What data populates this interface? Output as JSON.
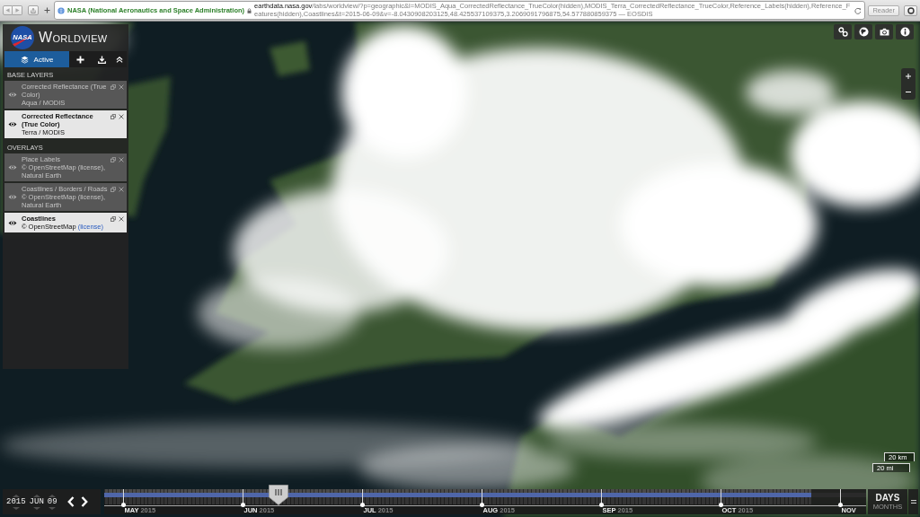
{
  "browser": {
    "identity": "NASA (National Aeronautics and Space Administration)",
    "url_host": "earthdata.nasa.gov",
    "url_path": "/labs/worldview/?p=geographic&l=MODIS_Aqua_CorrectedReflectance_TrueColor(hidden),MODIS_Terra_CorrectedReflectance_TrueColor,Reference_Labels(hidden),Reference_Features(hidden),Coastlines&t=2015-06-09&v=-8.0430908203125,48.425537109375,3.2069091796875,54.577880859375 — EOSDIS",
    "reader": "Reader"
  },
  "app": {
    "logo_text": "NASA",
    "title": "WORLDVIEW"
  },
  "tabs": [
    {
      "kind": "layers",
      "label": "Active",
      "selected": true
    },
    {
      "kind": "add",
      "selected": false
    },
    {
      "kind": "download",
      "selected": false
    }
  ],
  "sections": [
    {
      "heading": "BASE LAYERS",
      "layers": [
        {
          "title": "Corrected Reflectance (True Color)",
          "source": "Aqua / MODIS",
          "visible": false
        },
        {
          "title": "Corrected Reflectance (True Color)",
          "source": "Terra / MODIS",
          "visible": true
        }
      ]
    },
    {
      "heading": "OVERLAYS",
      "layers": [
        {
          "title": "Place Labels",
          "source": "© OpenStreetMap",
          "license": "(license)",
          "source_end": ", Natural Earth",
          "visible": false
        },
        {
          "title": "Coastlines / Borders / Roads",
          "source": "© OpenStreetMap",
          "license": "(license)",
          "source_end": ", Natural Earth",
          "visible": false
        },
        {
          "title": "Coastlines",
          "source": "© OpenStreetMap",
          "license": "(license)",
          "visible": true
        }
      ]
    }
  ],
  "scale": {
    "metric": "20 km",
    "imperial": "20 mi"
  },
  "timeline": {
    "date": {
      "year": "2015",
      "month": "JUN",
      "day": "09"
    },
    "coverage": {
      "level": 0.928
    },
    "handle": {
      "level": 0.229
    },
    "months": [
      {
        "label": "MAY",
        "year": "2015"
      },
      {
        "label": "JUN",
        "year": "2015"
      },
      {
        "label": "JUL",
        "year": "2015"
      },
      {
        "label": "AUG",
        "year": "2015"
      },
      {
        "label": "SEP",
        "year": "2015"
      },
      {
        "label": "OCT",
        "year": "2015"
      },
      {
        "label": "NOV"
      }
    ],
    "zoom_levels": [
      {
        "label": "DAYS",
        "selected": true
      },
      {
        "label": "MONTHS",
        "selected": false
      }
    ]
  }
}
